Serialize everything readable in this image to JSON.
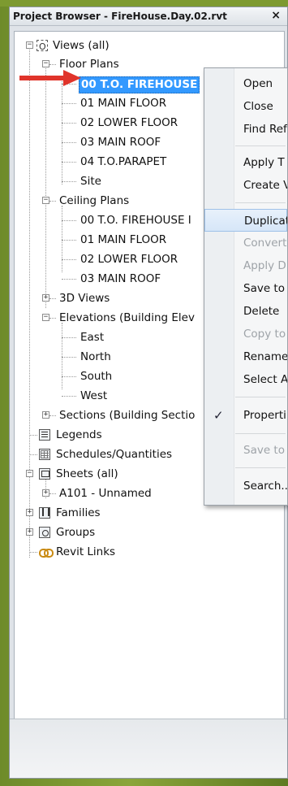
{
  "window": {
    "title": "Project Browser - FireHouse.Day.02.rvt",
    "close_glyph": "×"
  },
  "tree": {
    "views_all": "Views (all)",
    "floor_plans": "Floor Plans",
    "floor_plan_items": [
      "00 T.O. FIREHOUSE",
      "01 MAIN FLOOR",
      "02 LOWER FLOOR",
      "03 MAIN ROOF",
      "04  T.O.PARAPET",
      "Site"
    ],
    "ceiling_plans": "Ceiling Plans",
    "ceiling_plan_items": [
      "00 T.O. FIREHOUSE I",
      "01 MAIN FLOOR",
      "02 LOWER FLOOR",
      "03 MAIN ROOF"
    ],
    "views_3d": "3D Views",
    "elevations": "Elevations (Building Elev",
    "elevation_items": [
      "East",
      "North",
      "South",
      "West"
    ],
    "sections": "Sections (Building Sectio",
    "legends": "Legends",
    "schedules": "Schedules/Quantities",
    "sheets": "Sheets (all)",
    "sheet_items": [
      "A101 - Unnamed"
    ],
    "families": "Families",
    "groups": "Groups",
    "revit_links": "Revit Links"
  },
  "context_menu": {
    "items": [
      "Open",
      "Close",
      "Find Ref",
      "Apply T",
      "Create V",
      "Duplicat",
      "Convert",
      "Apply D",
      "Save to",
      "Delete",
      "Copy to",
      "Rename",
      "Select A",
      "Properti",
      "Save to",
      "Search..."
    ],
    "checked_glyph": "✓"
  },
  "colors": {
    "selection": "#3399ff",
    "arrow": "#e0342b",
    "frame_green": "#7d9a30"
  }
}
